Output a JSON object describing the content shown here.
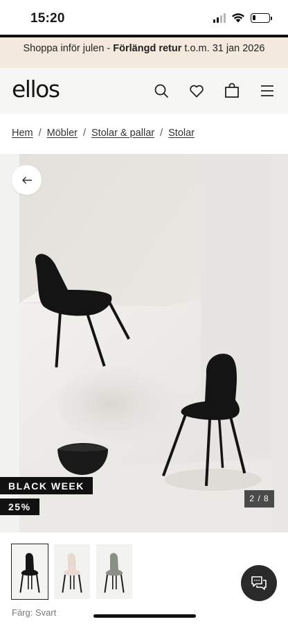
{
  "status_bar": {
    "time": "15:20",
    "battery_level": 0.2
  },
  "promo_banner": {
    "text_before": "Shoppa inför julen - ",
    "text_bold": "Förlängd retur",
    "text_after": " t.o.m. 31 jan 2026"
  },
  "header": {
    "logo": "ellos",
    "icons": [
      "search-icon",
      "heart-icon",
      "bag-icon",
      "menu-icon"
    ]
  },
  "breadcrumb": {
    "items": [
      "Hem",
      "Möbler",
      "Stolar & pallar",
      "Stolar"
    ],
    "separator": "/"
  },
  "gallery": {
    "tag_campaign": "BLACK WEEK",
    "tag_discount": "25%",
    "page_counter": "2 / 8"
  },
  "thumbnails": {
    "colors": [
      "#151515",
      "#e9d9cf",
      "#8a8f88"
    ]
  },
  "product": {
    "color_label": "Färg: Svart"
  }
}
